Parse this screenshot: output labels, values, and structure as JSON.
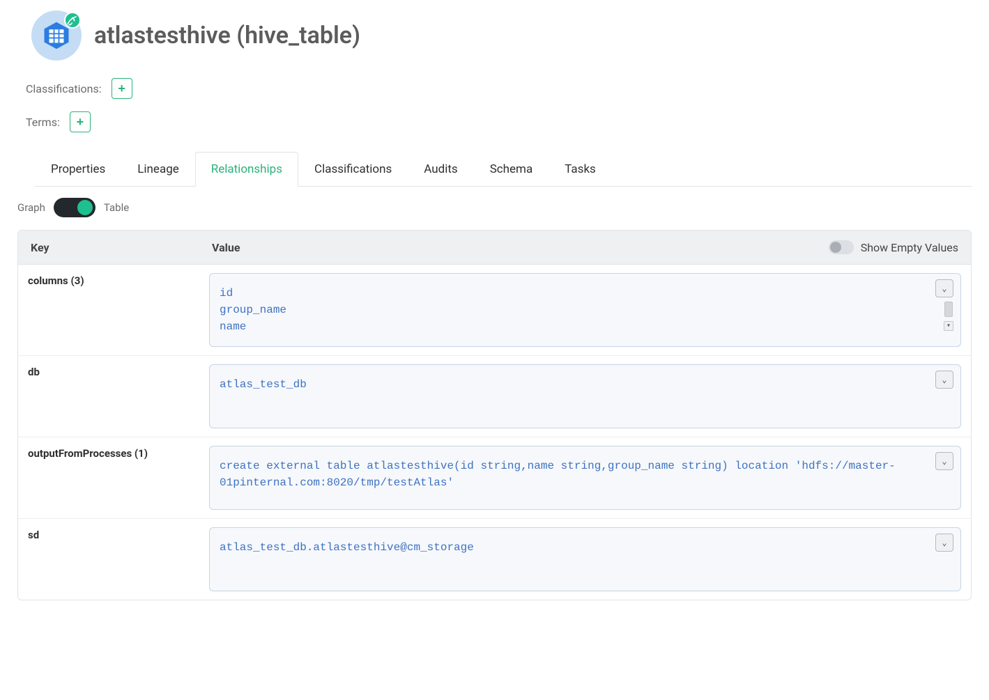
{
  "header": {
    "title": "atlastesthive (hive_table)"
  },
  "tags": {
    "classifications_label": "Classifications:",
    "terms_label": "Terms:"
  },
  "tabs": [
    {
      "id": "properties",
      "label": "Properties",
      "active": false
    },
    {
      "id": "lineage",
      "label": "Lineage",
      "active": false
    },
    {
      "id": "relationships",
      "label": "Relationships",
      "active": true
    },
    {
      "id": "classifications",
      "label": "Classifications",
      "active": false
    },
    {
      "id": "audits",
      "label": "Audits",
      "active": false
    },
    {
      "id": "schema",
      "label": "Schema",
      "active": false
    },
    {
      "id": "tasks",
      "label": "Tasks",
      "active": false
    }
  ],
  "viewToggle": {
    "left_label": "Graph",
    "right_label": "Table",
    "value": "table"
  },
  "tableHeader": {
    "key_label": "Key",
    "value_label": "Value",
    "show_empty_label": "Show Empty Values",
    "show_empty_on": false
  },
  "rows": [
    {
      "key": "columns",
      "count": 3,
      "values": [
        "id",
        "group_name",
        "name"
      ],
      "show_scroll": true
    },
    {
      "key": "db",
      "values": [
        "atlas_test_db"
      ]
    },
    {
      "key": "outputFromProcesses",
      "count": 1,
      "values": [
        "create external table atlastesthive(id string,name string,group_name string) location 'hdfs://master-01pinternal.com:8020/tmp/testAtlas'"
      ]
    },
    {
      "key": "sd",
      "values": [
        "atlas_test_db.atlastesthive@cm_storage"
      ]
    }
  ]
}
